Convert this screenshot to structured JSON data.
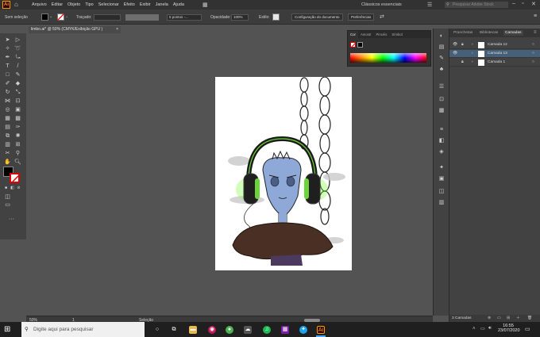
{
  "menubar": {
    "app_logo": "Ai",
    "items": [
      "Arquivo",
      "Editar",
      "Objeto",
      "Tipo",
      "Selecionar",
      "Efeito",
      "Exibir",
      "Janela",
      "Ajuda"
    ],
    "workspace": "Clássicos essenciais",
    "search_placeholder": "Pesquisar Adobe Stock"
  },
  "controlbar": {
    "selection_label": "Sem seleção",
    "stroke_label": "Traçado:",
    "brush_label": "5 pontos -...",
    "opacity_label": "Opacidade:",
    "opacity_value": "100%",
    "style_label": "Estilo:",
    "doc_setup_button": "Configuração do documento",
    "preferences_button": "Preferências"
  },
  "document": {
    "tab_title": "limbo.ai* @ 50% (CMYK/Exibição GPU )"
  },
  "color_panel": {
    "tabs": [
      "Cor",
      "Amostr",
      "Pincéis",
      "Símbol"
    ],
    "active_tab": "Cor"
  },
  "layers_panel": {
    "tabs": [
      "Pranchetas",
      "Bibliotecas",
      "Camadas"
    ],
    "active_tab": "Camadas",
    "layers": [
      {
        "name": "Camada 12",
        "selected": false
      },
      {
        "name": "Camada 13",
        "selected": true
      },
      {
        "name": "Camada 1",
        "selected": false
      }
    ],
    "footer_count": "3 Camadas"
  },
  "statusbar": {
    "zoom": "50%",
    "artboard_number": "1",
    "tool": "Seleção"
  },
  "taskbar": {
    "search_placeholder": "Digite aqui para pesquisar",
    "time": "16:55",
    "date": "23/07/2020"
  },
  "colors": {
    "accent_orange": "#ff9a00",
    "selected_layer": "#46607a",
    "headphone_green": "#7cff3a",
    "character_blue": "#8ea8d8",
    "cloak_brown": "#4a2f24"
  }
}
